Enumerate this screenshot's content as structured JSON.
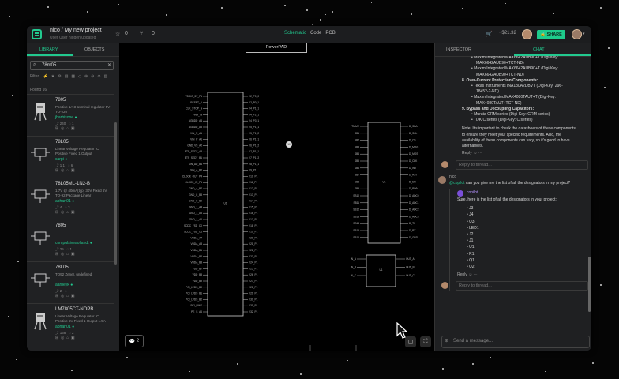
{
  "topbar": {
    "project_path": "nico / My new project",
    "subtitle": "User User hidden updated",
    "stars": "0",
    "forks": "0",
    "views": [
      "Schematic",
      "Code",
      "PCB"
    ],
    "active_view": "Schematic",
    "price": "~$21.32",
    "share_label": "SHARE"
  },
  "library": {
    "tabs": [
      "LIBRARY",
      "OBJECTS"
    ],
    "search_value": "78m05",
    "filter_label": "Filter",
    "found_label": "Found 16",
    "parts": [
      {
        "name": "7805",
        "desc": "Positive 1A 3-terminal regulator 5V TO-220",
        "author": "jharbisone",
        "likes": "240",
        "comments": "1"
      },
      {
        "name": "78L05",
        "desc": "Linear Voltage Regulator IC Positive Fixed 1 Output",
        "author": "carpi",
        "likes": "1.1",
        "comments": "6"
      },
      {
        "name": "78L05ML-1N2-B",
        "desc": "1.7V @ 40mA(typ) 30V Fixed 5V TO-92 Package Linear",
        "author": "abhart01",
        "likes": "4",
        "comments": "3"
      },
      {
        "name": "7805",
        "desc": "",
        "author": "compulsiveaoliandt",
        "likes": "25",
        "comments": "1"
      },
      {
        "name": "78L05",
        "desc": "TO92 Zener, undefined",
        "author": "aarbeyk",
        "likes": "2",
        "comments": ""
      },
      {
        "name": "LM7805CT-NOPB",
        "desc": "Linear Voltage Regulator IC Positive 5V Fixed 1 Output 1.5A",
        "author": "abhart01",
        "likes": "158",
        "comments": "2"
      }
    ]
  },
  "canvas": {
    "powerpad_label": "PowerPAD",
    "comments_count": "2",
    "pin_marker": "10",
    "ic1_pins_left": [
      "VDDIO_3V_P1",
      "RESET_N",
      "CLK_STOP_N",
      "VINA_IN",
      "AGNDD_A4",
      "AGNDD_A5",
      "VIN_N_A1",
      "VIN_P_A1",
      "GND_VS_A2",
      "BTS_SEDT_A3",
      "BTS_SEDT_B1",
      "SIN_AD_B4",
      "SIN_A_B6",
      "CLOCK_OUT_P4",
      "CLOCK_IN_P1",
      "GND_A_B7",
      "GND_C_B8",
      "GND_C_B9",
      "GND_1_A4",
      "GND_1_A5",
      "GND_1_A6",
      "SCDC_FSD_C0",
      "SCDC_FSD_C1",
      "VDDA_A7",
      "VDDA_A8",
      "VDDA_B1",
      "VDDA_B2",
      "VDDA_B3",
      "VDD_B7",
      "VDD_B8",
      "VDD_B9",
      "PCI_LVDS_B0",
      "PCI_LVDS_B1",
      "PCI_LVDS_B2",
      "PCI_PINS",
      "PE_S_A6"
    ],
    "ic1_pins_right": [
      "Y2_P0_0",
      "Y2_P0_1",
      "Y4_P1_1",
      "Y4_P2_1",
      "Y4_P3_1",
      "Y5_P1_1",
      "Y5_P1_2",
      "Y6_P1_1",
      "Y6_P1_2",
      "Y7_P1_1",
      "Y7_P1_2",
      "Y8_P1_1",
      "Y9_P1",
      "Y10_P1",
      "Y11_P1",
      "Y12_P1",
      "Y13_P1",
      "Y14_P1",
      "Y15_P1",
      "Y16_P1",
      "Y17_P1",
      "Y18_P1",
      "Y19_P1",
      "Y20_P1",
      "Y21_P1",
      "Y22_P1",
      "Y23_P1",
      "Y24_P1",
      "Y25_P1",
      "Y26_P1",
      "Y27_P1",
      "Y28_P1",
      "Y29_P1",
      "Y30_P1",
      "Y31_P1",
      "Y32_P1"
    ],
    "ic2_pins_left": [
      "FRAME",
      "SB1",
      "SB2",
      "SB3",
      "SB4",
      "SB5",
      "SB6",
      "SB7",
      "SB8",
      "SB9",
      "SB10",
      "SB11",
      "SB12",
      "SB13",
      "SB14",
      "SB15",
      "SB16"
    ],
    "ic2_pins_right": [
      "D_SDA",
      "D_SCL",
      "D_CS",
      "D_MISO",
      "D_MOSI",
      "D_CLK",
      "D_INT",
      "D_RST",
      "D_EN",
      "D_PWM",
      "D_ADC0",
      "D_ADC1",
      "D_ADC2",
      "D_ADC3",
      "D_TX",
      "D_RX",
      "D_GND"
    ],
    "ic3_pins_left": [
      "IN_A",
      "IN_B",
      "IN_C"
    ],
    "ic3_pins_right": [
      "OUT_A",
      "OUT_B",
      "OUT_C"
    ],
    "ic_ref": "U1"
  },
  "panel": {
    "tabs": [
      "INSPECTOR",
      "CHAT"
    ],
    "active_tab": "CHAT",
    "reply_placeholder": "Reply to thread...",
    "send_placeholder": "Send a message...",
    "prev_message": [
      "Maxim Integrated MAX6642AUB90+T (Digi-Key:",
      "MAX6642AUB90+TCT-ND)",
      "Maxim Integrated MAX6642AUB90+T (Digi-Key:",
      "MAX6642AUB90+TCT-ND)",
      "8. Over-Current Protection Components:",
      "Texas Instruments INA180A2DBVT (Digi-Key: 296-",
      "18452-2-ND)",
      "Maxim Integrated MAX4080TAUT+T (Digi-Key:",
      "MAX4080TAUT+TCT-ND)",
      "9. Bypass and Decoupling Capacitors:",
      "Murata GRM series (Digi-Key: GRM series)",
      "TDK C series (Digi-Key: C series)",
      "Note: It's important to check the datasheets of these components",
      "to ensure they meet your specific requirements. Also, the",
      "availability of these components can vary, so it's good to have",
      "alternatives."
    ],
    "reply_label": "Reply",
    "user_name": "nico",
    "user_msg_mention": "@copilot",
    "user_msg_text": "can you give me the list of all the designators in my project?",
    "bot_name": "copilot",
    "bot_intro": "Sure, here is the list of all the designators in your project:",
    "designators": [
      "J3",
      "J4",
      "U3",
      "LED1",
      "J2",
      "J1",
      "U1",
      "R1",
      "Q1",
      "U2"
    ]
  }
}
